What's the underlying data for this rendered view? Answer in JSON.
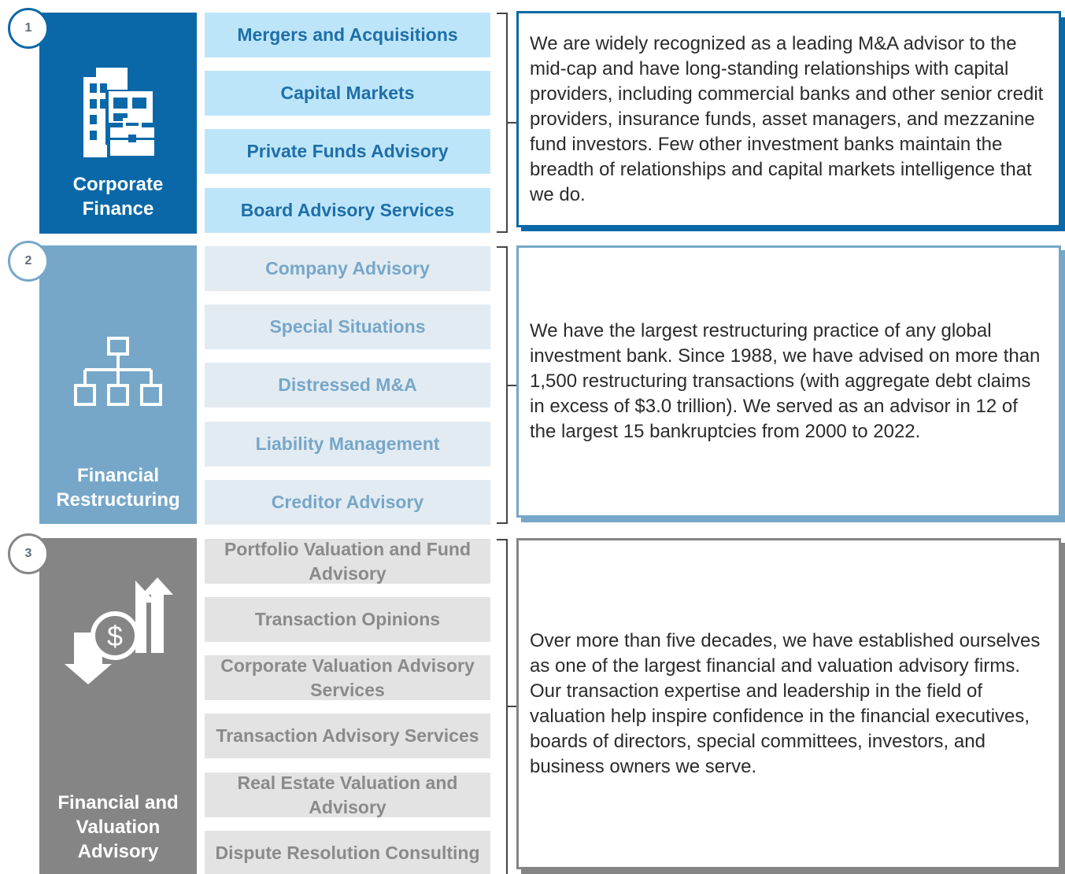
{
  "sections": [
    {
      "number": "1",
      "title": "Corporate\nFinance",
      "icon": "office-building-briefcase-icon",
      "color": "#0a68a8",
      "service_bg": "#bde5f9",
      "service_text": "#1e6fa9",
      "services": [
        "Mergers and Acquisitions",
        "Capital Markets",
        "Private Funds Advisory",
        "Board Advisory Services"
      ],
      "description": "We are widely recognized as a leading M&A advisor to the mid-cap and have long-standing relationships with capital providers, including commercial banks and other senior credit providers, insurance funds, asset managers, and mezzanine fund investors. Few other investment banks maintain the breadth of relationships and capital markets intelligence that we do."
    },
    {
      "number": "2",
      "title": "Financial\nRestructuring",
      "icon": "org-chart-icon",
      "color": "#76a7c9",
      "service_bg": "#e3ebf2",
      "service_text": "#76a7c9",
      "services": [
        "Company Advisory",
        "Special Situations",
        "Distressed M&A",
        "Liability Management",
        "Creditor Advisory"
      ],
      "description": "We have the largest restructuring practice of any global investment bank. Since 1988, we have advised on more than 1,500 restructuring transactions (with aggregate debt claims in excess of $3.0 trillion). We served as an advisor in 12 of the largest 15 bankruptcies from 2000 to 2022."
    },
    {
      "number": "3",
      "title": "Financial and\nValuation\nAdvisory",
      "icon": "dollar-exchange-arrows-icon",
      "color": "#858585",
      "service_bg": "#e3e3e3",
      "service_text": "#8a8a8a",
      "services": [
        "Portfolio Valuation and Fund Advisory",
        "Transaction Opinions",
        "Corporate Valuation Advisory Services",
        "Transaction Advisory Services",
        "Real Estate Valuation and Advisory",
        "Dispute Resolution Consulting"
      ],
      "description": "Over more than five decades, we have established ourselves as one of the largest financial and valuation advisory firms. Our transaction expertise and leadership in the field of valuation help inspire confidence in the financial executives, boards of directors, special committees, investors, and business owners we serve."
    }
  ]
}
